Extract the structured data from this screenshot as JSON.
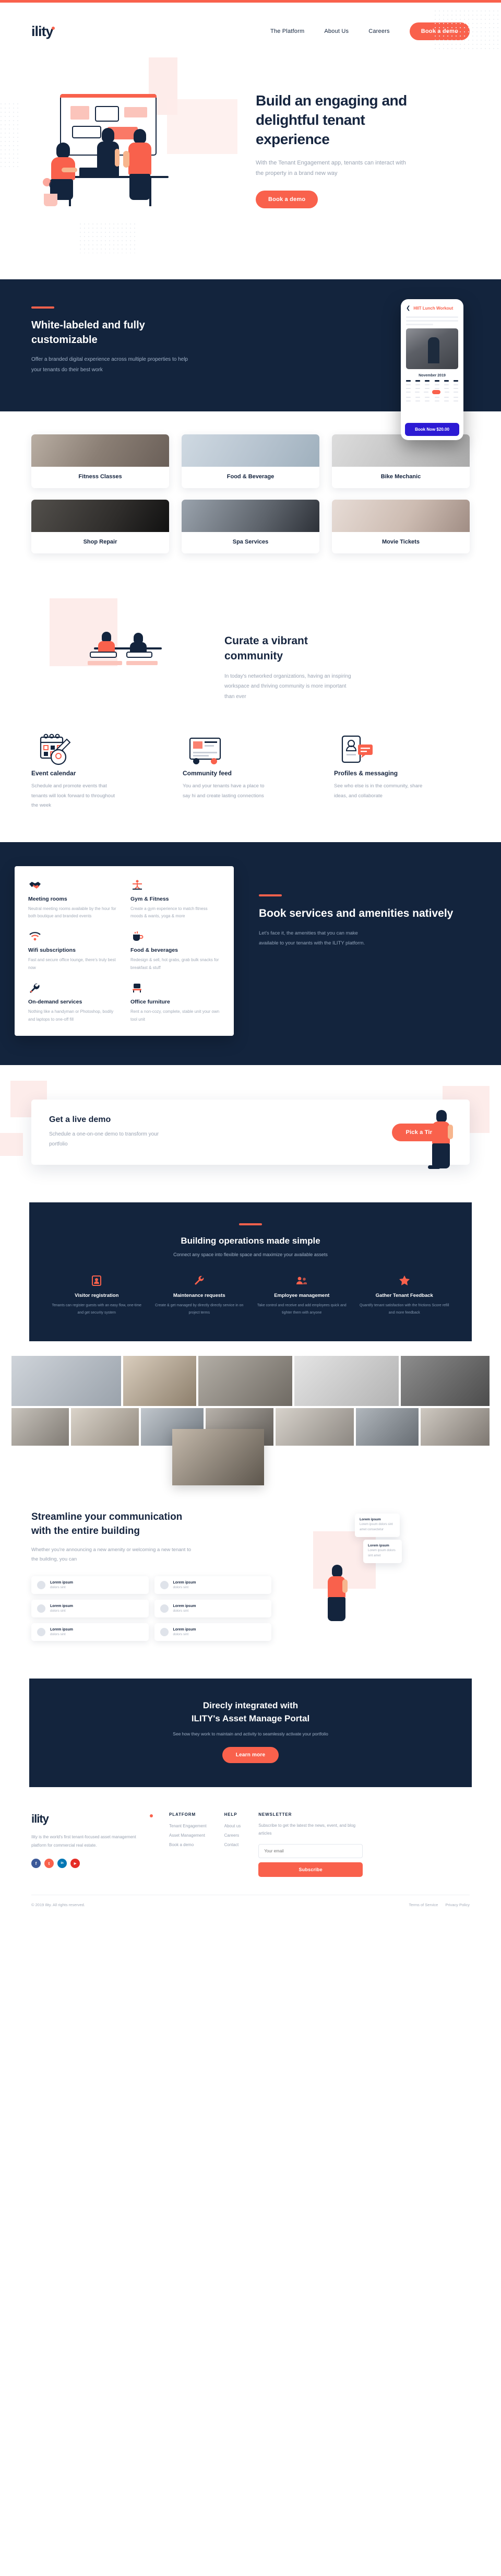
{
  "brand": {
    "name": "ility",
    "accent": "#f9614c",
    "navy": "#13243d"
  },
  "header": {
    "nav": [
      {
        "label": "The Platform"
      },
      {
        "label": "About Us"
      },
      {
        "label": "Careers"
      }
    ],
    "cta": "Book a demo"
  },
  "hero": {
    "title": "Build an engaging and delightful tenant experience",
    "body": "With the Tenant Engagement app, tenants can interact with the property in a brand new way",
    "cta": "Book a demo"
  },
  "whitelabel": {
    "title": "White-labeled and fully customizable",
    "body": "Offer a branded digital experience across multiple properties to help your tenants do their best work",
    "phone": {
      "back_icon": "chevron-left-icon",
      "title": "HIIT Lunch Workout",
      "month": "November 2019",
      "book_button": "Book Now $20.00"
    },
    "categories": [
      {
        "label": "Fitness Classes"
      },
      {
        "label": "Food & Beverage"
      },
      {
        "label": "Bike Mechanic"
      },
      {
        "label": "Shop Repair"
      },
      {
        "label": "Spa Services"
      },
      {
        "label": "Movie Tickets"
      }
    ]
  },
  "curate": {
    "title": "Curate a vibrant community",
    "body": "In today's networked organizations, having an inspiring workspace and thriving community is more important than ever",
    "features": [
      {
        "icon": "calendar-guitar-icon",
        "title": "Event calendar",
        "body": "Schedule and promote events that tenants will look forward to throughout the week"
      },
      {
        "icon": "community-feed-icon",
        "title": "Community feed",
        "body": "You and your tenants have a place to say hi and create lasting connections"
      },
      {
        "icon": "profiles-messaging-icon",
        "title": "Profiles & messaging",
        "body": "See who else is in the community, share ideas, and collaborate"
      }
    ]
  },
  "book": {
    "title": "Book services and amenities natively",
    "body": "Let's face it, the amenities that you can make available to your tenants with the ILITY platform.",
    "items": [
      {
        "icon": "handshake-icon",
        "title": "Meeting rooms",
        "body": "Neutral meeting rooms available by the hour for both boutique and branded events"
      },
      {
        "icon": "yoga-icon",
        "title": "Gym & Fitness",
        "body": "Create a gym experience to match fitness moods & wants, yoga & more"
      },
      {
        "icon": "wifi-icon",
        "title": "Wifi subscriptions",
        "body": "Fast and secure office lounge, there's truly best now"
      },
      {
        "icon": "coffee-icon",
        "title": "Food & beverages",
        "body": "Redesign & sell, hot grabs, grab bulk snacks for breakfast & stuff"
      },
      {
        "icon": "wrench-icon",
        "title": "On-demand services",
        "body": "Nothing like a handyman or Photoshop, bodily and laptops to one-off fill"
      },
      {
        "icon": "chair-icon",
        "title": "Office furniture",
        "body": "Rent a non-cozy, complete, stable unit your own tool unit"
      }
    ]
  },
  "demo": {
    "title": "Get a live demo",
    "body": "Schedule a one-on-one demo to transform your portfolio",
    "cta": "Pick a Time"
  },
  "ops": {
    "title": "Building operations made simple",
    "subtitle": "Connect any space into flexible space and maximize your available assets",
    "items": [
      {
        "icon": "visitor-registration-icon",
        "title": "Visitor registration",
        "body": "Tenants can register guests with an easy flow, one-time and get security system"
      },
      {
        "icon": "maintenance-requests-icon",
        "title": "Maintenance requests",
        "body": "Create & get managed by directly directly service in on project terms"
      },
      {
        "icon": "employee-management-icon",
        "title": "Employee management",
        "body": "Take control and receive and add employees quick and tighter them with anyone"
      },
      {
        "icon": "gather-tenant-feedback-icon",
        "title": "Gather Tenant Feedback",
        "body": "Quantify tenant satisfaction with the frictions Score refill and more feedback"
      }
    ]
  },
  "stream": {
    "title": "Streamline your communication with the entire building",
    "body": "Whether you're announcing a new amenity or welcoming a new tenant to the building, you can",
    "messages": [
      {
        "title": "Lorem ipsum",
        "subtitle": "dolors sint"
      },
      {
        "title": "Lorem ipsum",
        "subtitle": "dolors sint"
      },
      {
        "title": "Lorem ipsum",
        "subtitle": "dolors sint"
      },
      {
        "title": "Lorem ipsum",
        "subtitle": "dolors sint"
      },
      {
        "title": "Lorem ipsum",
        "subtitle": "dolors sint"
      },
      {
        "title": "Lorem ipsum",
        "subtitle": "dolors sint"
      }
    ],
    "bubbles": [
      {
        "title": "Lorem ipsum",
        "body": "Lorem ipsum dolors sint amet consectetur"
      },
      {
        "title": "Lorem ipsum",
        "body": "Lorem ipsum dolors sint amet"
      }
    ]
  },
  "integrated": {
    "title_line1": "Direcly integrated with",
    "title_line2": "ILITY's Asset Manage Portal",
    "subtitle": "See how they work to maintain and activity to seamlessly activate your portfolio",
    "cta": "Learn more"
  },
  "footer": {
    "logo": "ility",
    "about": "Ility is the world's first tenant-focused asset management platform for commercial real estate.",
    "columns": [
      {
        "heading": "PLATFORM",
        "links": [
          {
            "label": "Tenant Engagement"
          },
          {
            "label": "Asset Management"
          },
          {
            "label": "Book a demo"
          }
        ]
      },
      {
        "heading": "HELP",
        "links": [
          {
            "label": "About us"
          },
          {
            "label": "Careers"
          },
          {
            "label": "Contact"
          }
        ]
      }
    ],
    "newsletter": {
      "heading": "NEWSLETTER",
      "body": "Subscribe to get the latest the news, event, and blog articles",
      "placeholder": "Your email",
      "button": "Subscribe"
    },
    "socials": [
      {
        "name": "facebook-icon",
        "glyph": "f",
        "color": "#3b5998"
      },
      {
        "name": "twitter-icon",
        "glyph": "t",
        "color": "#f9614c"
      },
      {
        "name": "linkedin-icon",
        "glyph": "in",
        "color": "#0077b5"
      },
      {
        "name": "youtube-icon",
        "glyph": "▶",
        "color": "#e52d27"
      }
    ],
    "copyright": "© 2019 Ility. All rights reserved.",
    "legal": [
      {
        "label": "Terms of Service"
      },
      {
        "label": "Privacy Policy"
      }
    ]
  }
}
